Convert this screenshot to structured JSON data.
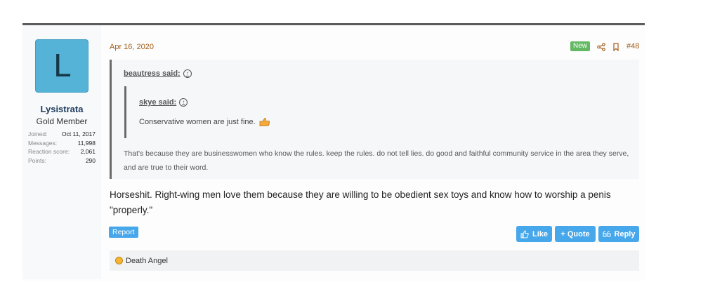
{
  "user": {
    "avatar_letter": "L",
    "name": "Lysistrata",
    "title": "Gold Member",
    "stats": [
      {
        "label": "Joined:",
        "value": "Oct 11, 2017"
      },
      {
        "label": "Messages:",
        "value": "11,998"
      },
      {
        "label": "Reaction score:",
        "value": "2,061"
      },
      {
        "label": "Points:",
        "value": "290"
      }
    ],
    "avatar_color": "#55b3d7"
  },
  "post": {
    "date": "Apr 16, 2020",
    "new_badge": "New",
    "number": "#48",
    "quote": {
      "author": "beautress said:",
      "text": "That's because they are businesswomen who know the rules. keep the rules. do not tell lies. do good and faithful community service in the area they serve, and are true to their word.",
      "nested": {
        "author": "skye said:",
        "text": "Conservative women are just fine."
      }
    },
    "message": "Horseshit. Right-wing men love them because they are willing to be obedient sex toys and know how to worship a penis \"properly.\"",
    "report_label": "Report",
    "like_label": "Like",
    "quote_label": "+ Quote",
    "reply_label": "Reply",
    "reaction_user": "Death Angel"
  },
  "colors": {
    "accent": "#47a7eb",
    "date": "#a35d18",
    "new_badge": "#63b863"
  }
}
